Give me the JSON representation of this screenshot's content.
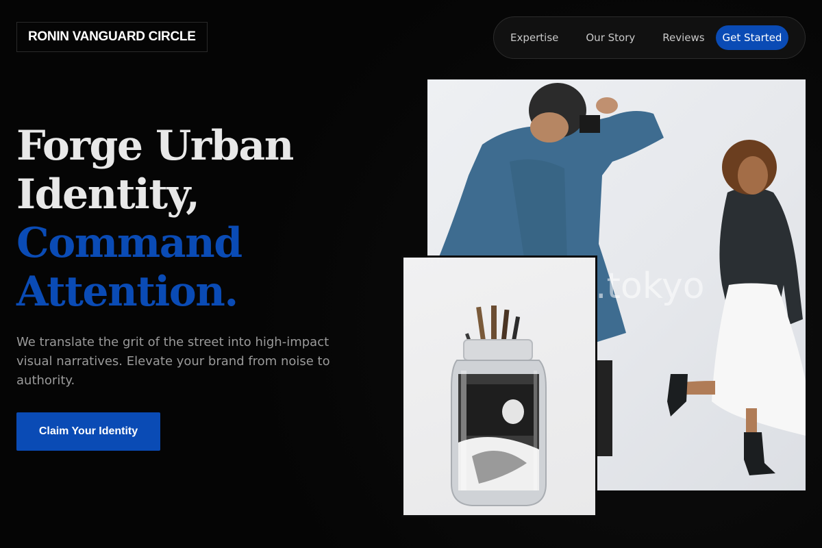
{
  "brand": {
    "name": "RONIN VANGUARD CIRCLE"
  },
  "nav": {
    "links": [
      "Expertise",
      "Our Story",
      "Reviews"
    ],
    "cta": "Get Started"
  },
  "hero": {
    "headline_line1": "Forge Urban",
    "headline_line2": "Identity,",
    "headline_line3": "Command",
    "headline_line4": "Attention.",
    "subtext": "We translate the grit of the street into high-impact visual narratives. Elevate your brand from noise to authority.",
    "cta": "Claim Your Identity"
  },
  "images": {
    "main_watermark": ".tokyo"
  },
  "colors": {
    "accent": "#0a4bb5",
    "background": "#050505",
    "headline_light": "#e8e8e8",
    "subtext": "#9a9a9a"
  }
}
